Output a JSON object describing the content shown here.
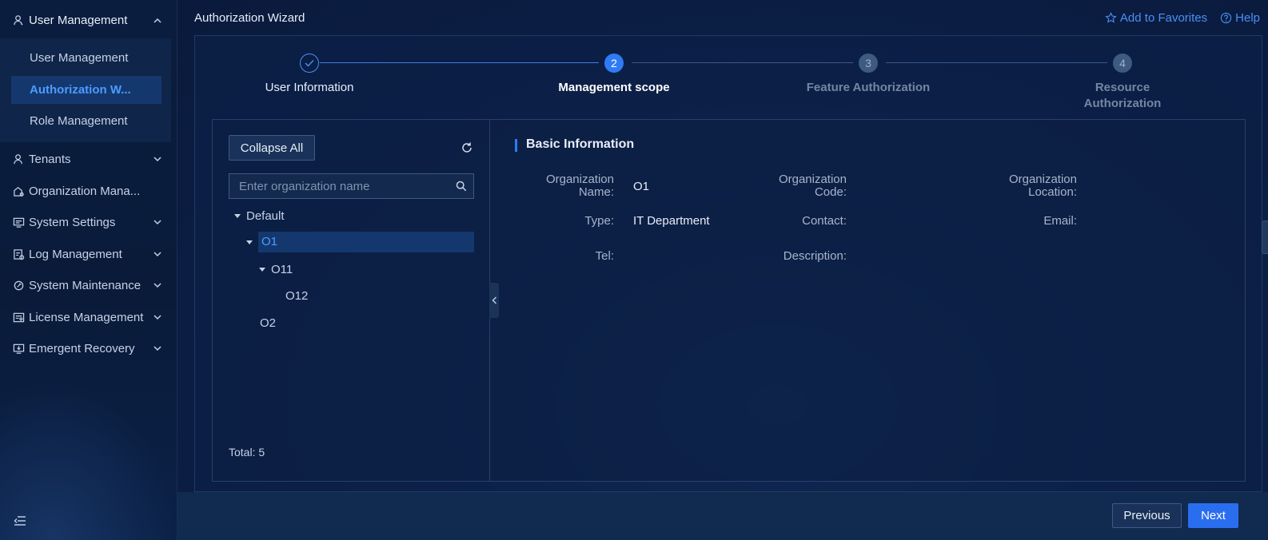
{
  "sidebar": {
    "group": {
      "label": "User Management",
      "icon": "user-icon"
    },
    "submenu": [
      {
        "label": "User Management",
        "active": false
      },
      {
        "label": "Authorization W...",
        "active": true
      },
      {
        "label": "Role Management",
        "active": false
      }
    ],
    "items": [
      {
        "label": "Tenants",
        "icon": "tenant-icon"
      },
      {
        "label": "Organization Mana...",
        "icon": "organization-icon"
      },
      {
        "label": "System Settings",
        "icon": "settings-icon"
      },
      {
        "label": "Log Management",
        "icon": "log-icon"
      },
      {
        "label": "System Maintenance",
        "icon": "maintenance-icon"
      },
      {
        "label": "License Management",
        "icon": "license-icon"
      },
      {
        "label": "Emergent Recovery",
        "icon": "recovery-icon"
      }
    ]
  },
  "header": {
    "title": "Authorization Wizard",
    "favorites_label": "Add to Favorites",
    "help_label": "Help"
  },
  "steps": [
    {
      "num": "1",
      "label": "User Information",
      "state": "done"
    },
    {
      "num": "2",
      "label": "Management scope",
      "state": "active"
    },
    {
      "num": "3",
      "label": "Feature Authorization",
      "state": "pending"
    },
    {
      "num": "4",
      "label": "Resource Authorization",
      "state": "pending"
    }
  ],
  "tree": {
    "collapse_label": "Collapse All",
    "search_placeholder": "Enter organization name",
    "nodes": [
      {
        "label": "Default",
        "expanded": true
      },
      {
        "label": "O1",
        "expanded": true,
        "selected": true
      },
      {
        "label": "O11",
        "expanded": true
      },
      {
        "label": "O12"
      },
      {
        "label": "O2"
      }
    ],
    "total": "Total: 5"
  },
  "details": {
    "section_title": "Basic Information",
    "fields": [
      {
        "label": "Organization Name:",
        "value": "O1"
      },
      {
        "label": "Organization Code:",
        "value": ""
      },
      {
        "label": "Organization Location:",
        "value": ""
      },
      {
        "label": "Type:",
        "value": "IT Department"
      },
      {
        "label": "Contact:",
        "value": ""
      },
      {
        "label": "Email:",
        "value": ""
      },
      {
        "label": "Tel:",
        "value": ""
      },
      {
        "label": "Description:",
        "value": ""
      }
    ]
  },
  "footer": {
    "previous_label": "Previous",
    "next_label": "Next"
  },
  "colors": {
    "accent": "#2a6ef0",
    "link": "#4a8ff5",
    "background": "#0a1a38"
  }
}
